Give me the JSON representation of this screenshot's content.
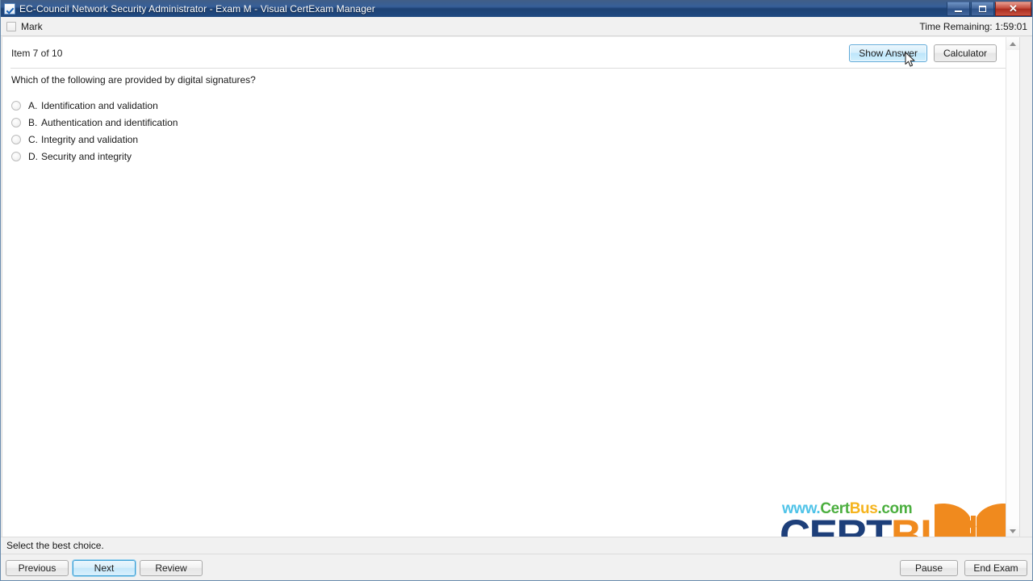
{
  "window": {
    "title": "EC-Council Network Security Administrator - Exam M - Visual CertExam Manager",
    "app_icon": "checkbox-icon",
    "minimize_label": "Minimize",
    "maximize_label": "Maximize",
    "close_label": "✕"
  },
  "markbar": {
    "mark_label": "Mark",
    "mark_checked": false,
    "time_label": "Time Remaining: 1:59:01"
  },
  "header": {
    "item_counter": "Item 7 of 10",
    "show_answer_label": "Show Answer",
    "calculator_label": "Calculator"
  },
  "question": {
    "text": "Which of the following are provided by digital signatures?",
    "options": [
      {
        "letter": "A.",
        "text": "Identification and validation",
        "selected": false
      },
      {
        "letter": "B.",
        "text": "Authentication and identification",
        "selected": false
      },
      {
        "letter": "C.",
        "text": "Integrity and validation",
        "selected": false
      },
      {
        "letter": "D.",
        "text": "Security and integrity",
        "selected": false
      }
    ]
  },
  "logo": {
    "url_www": "www.",
    "url_cert": "Cert",
    "url_bus": "Bus",
    "url_com": ".com",
    "main_cert": "CERT",
    "main_bus": "BUS",
    "colors": {
      "www": "#4fc3e8",
      "cert_green": "#4caf3f",
      "bus_yellow": "#f5b41e",
      "cert_blue": "#1d3f7a",
      "bus_orange": "#f08a1e"
    }
  },
  "statusbar": {
    "text": "Select the best choice."
  },
  "bottombar": {
    "previous_label": "Previous",
    "next_label": "Next",
    "review_label": "Review",
    "pause_label": "Pause",
    "end_exam_label": "End Exam"
  }
}
